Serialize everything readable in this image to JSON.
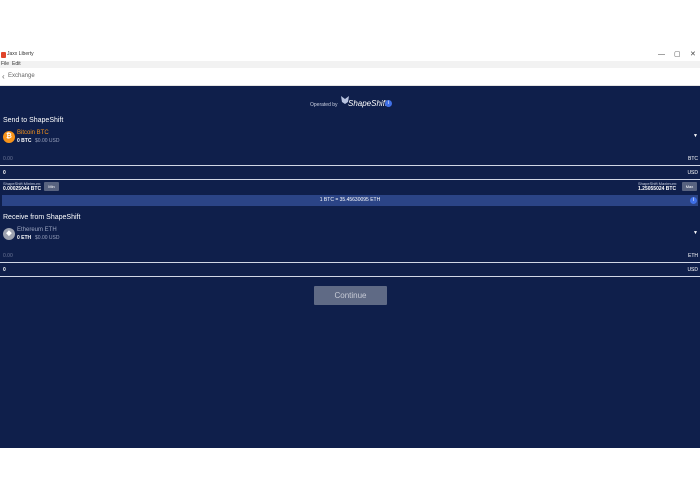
{
  "window": {
    "title": "Jaxx Liberty",
    "minimize": "—",
    "maximize": "▢",
    "close": "✕"
  },
  "menu": [
    "File",
    "Edit"
  ],
  "nav": {
    "back": "‹",
    "title": "Exchange"
  },
  "operated": {
    "prefix": "Operated by",
    "brand": "ShapeShift",
    "info": "i"
  },
  "send": {
    "heading": "Send to ShapeShift",
    "coin_name": "Bitcoin BTC",
    "coin_symbol": "₿",
    "balance": "0 BTC",
    "balance_usd": "$0.00 USD",
    "amount_placeholder": "0.00",
    "amount_unit": "BTC",
    "usd_value": "0",
    "usd_unit": "USD",
    "min_label": "ShapeShift Minimum:",
    "min_value": "0.00025044 BTC",
    "min_button": "Min",
    "max_label": "ShapeShift Maximum:",
    "max_value": "1.25055024 BTC",
    "max_button": "Max"
  },
  "rate": {
    "text": "1 BTC = 35.45630095 ETH",
    "info": "i"
  },
  "receive": {
    "heading": "Receive from ShapeShift",
    "coin_name": "Ethereum ETH",
    "coin_symbol": "◆",
    "balance": "0 ETH",
    "balance_usd": "$0.00 USD",
    "amount_placeholder": "0.00",
    "amount_unit": "ETH",
    "usd_value": "0",
    "usd_unit": "USD"
  },
  "continue_label": "Continue",
  "colors": {
    "background": "#0f1f4b",
    "bitcoin": "#f7931a",
    "accent": "#3f6fe6",
    "button": "#5f6a85"
  }
}
